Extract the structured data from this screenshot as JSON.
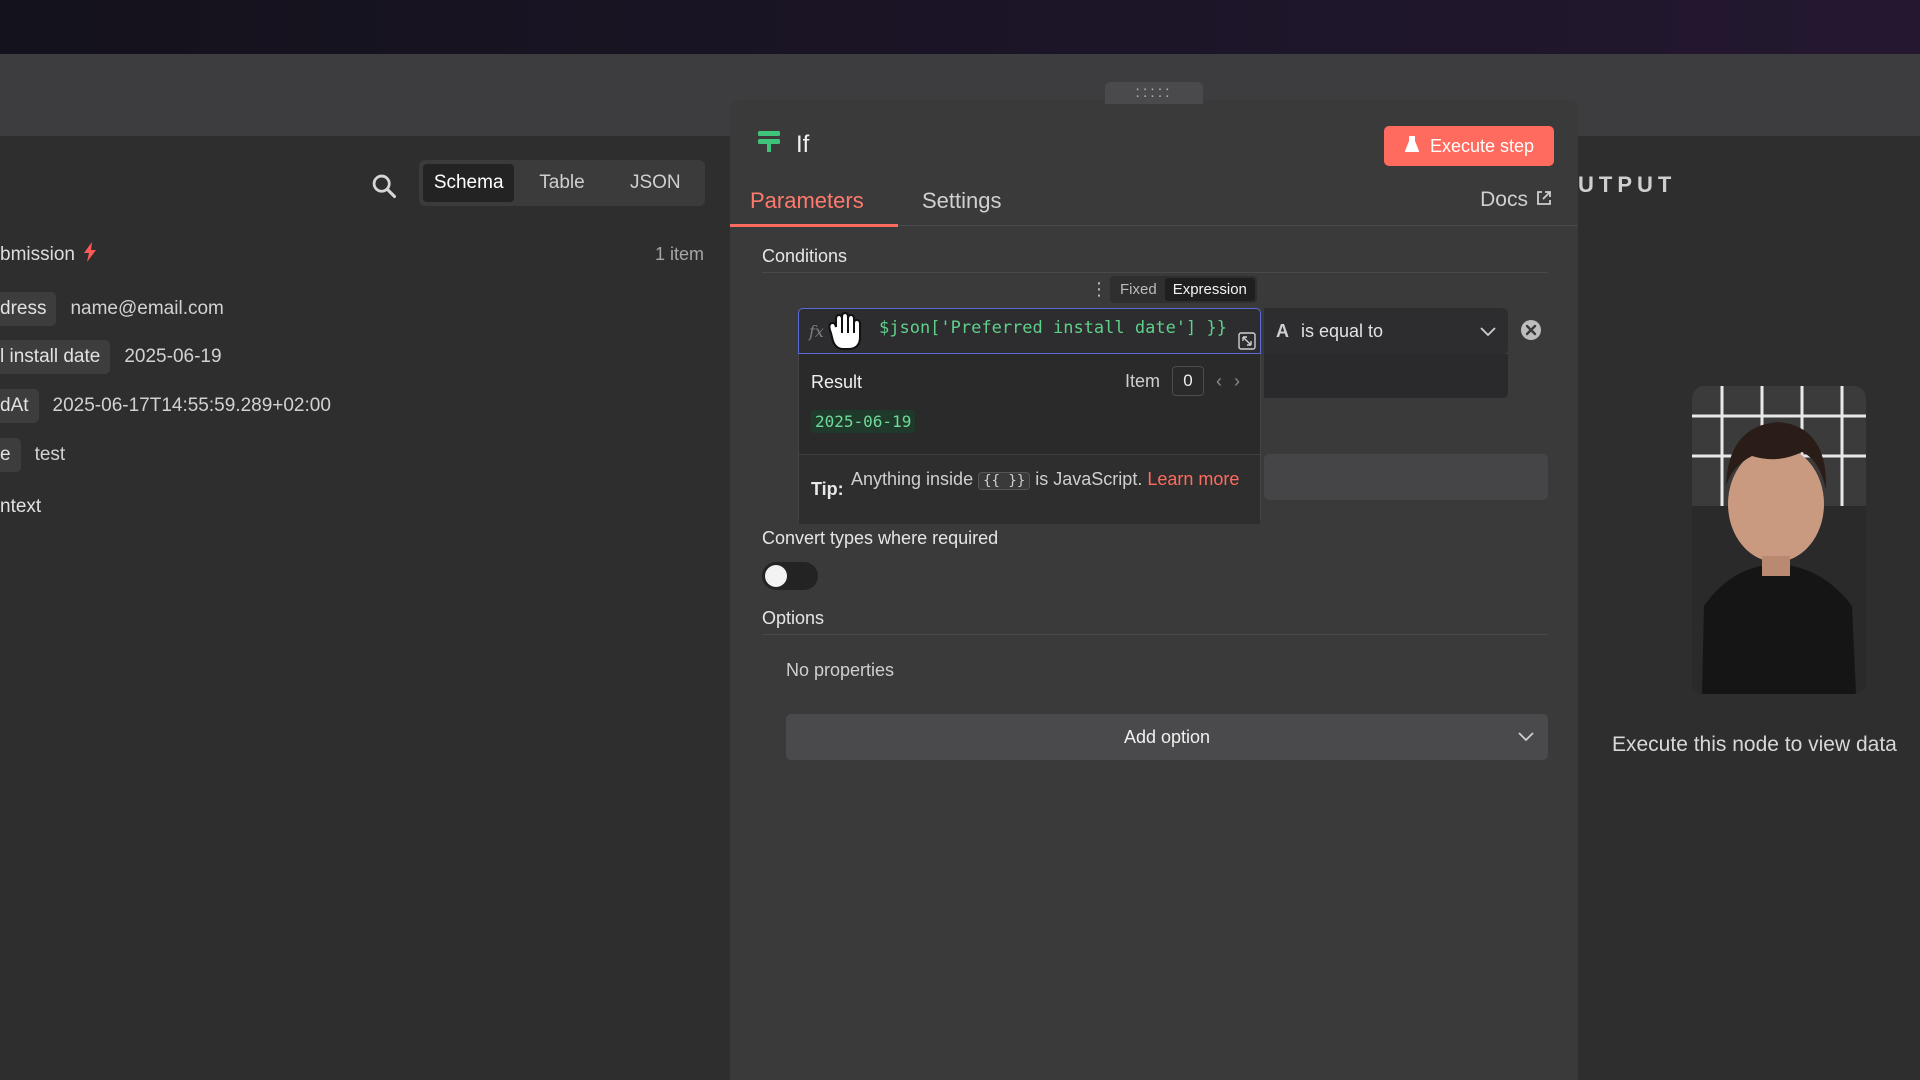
{
  "input": {
    "view_tabs": [
      "Schema",
      "Table",
      "JSON"
    ],
    "trigger_name": "bmission",
    "item_count": "1 item",
    "fields": [
      {
        "key": "dress",
        "value": "name@email.com"
      },
      {
        "key": "l install date",
        "value": "2025-06-19"
      },
      {
        "key": "dAt",
        "value": "2025-06-17T14:55:59.289+02:00"
      },
      {
        "key": "e",
        "value": "test"
      },
      {
        "key": "ntext",
        "value": ""
      }
    ]
  },
  "node": {
    "title": "If",
    "execute_label": "Execute step",
    "tabs": {
      "parameters": "Parameters",
      "settings": "Settings"
    },
    "docs_label": "Docs",
    "conditions_label": "Conditions",
    "mode": {
      "fixed": "Fixed",
      "expression": "Expression"
    },
    "fx": "fx",
    "expression": "$json['Preferred install date'] }}",
    "operator": {
      "type_icon": "A",
      "label": "is equal to"
    },
    "result": {
      "label": "Result",
      "item_label": "Item",
      "item_index": "0",
      "value": "2025-06-19",
      "tip_label": "Tip:",
      "tip_prefix": "Anything inside",
      "tip_code": "{{ }}",
      "tip_suffix": "is JavaScript.",
      "tip_link": "Learn more"
    },
    "convert_label": "Convert types where required",
    "convert_enabled": false,
    "options_label": "Options",
    "no_properties": "No properties",
    "add_option_label": "Add option"
  },
  "output": {
    "title": "UTPUT",
    "hint": "Execute this node to view data"
  },
  "colors": {
    "accent": "#ff6b5e",
    "expression_green": "#5fd08a",
    "focus_border": "#5a6bd8"
  }
}
